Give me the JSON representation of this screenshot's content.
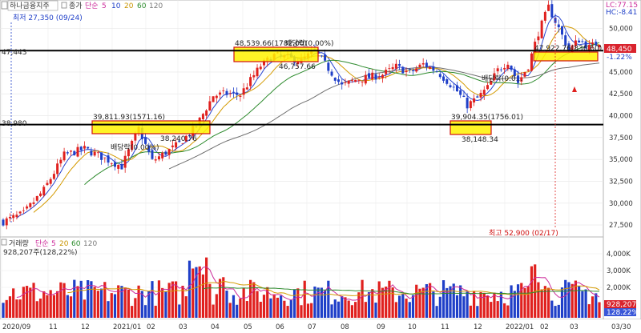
{
  "header": {
    "symbol": "하나금융지주",
    "price_series": "종가",
    "ma_type": "단순",
    "ma_periods": [
      "5",
      "10",
      "20",
      "60",
      "120"
    ],
    "ma_colors": [
      "#1a3cc8",
      "#c89400",
      "#2c8c2c",
      "#7a7a7a"
    ],
    "lc_label": "LC:77.15",
    "hc_label": "HC:-8.41"
  },
  "volume_header": {
    "title": "거래량",
    "ma_type": "단순",
    "ma_periods": [
      "5",
      "20",
      "60",
      "120"
    ],
    "current": "928,207주(128,22%)"
  },
  "annotations": {
    "low_label": "최저 27,350 (09/24)",
    "high_label": "최고 52,900 (02/17)",
    "hline_left_1": "47,443",
    "hline_left_2": "38,980",
    "box1_top": "39,811.93(1571.16)",
    "box1_bottom": "38,240.76",
    "box2_top": "48,539.66(1782.00)",
    "box2_dividend": "배당락(0.00%)",
    "box2_bottom": "46,757.66",
    "box3_top": "39,904.35(1756.01)",
    "box3_bottom": "38,148.34",
    "box4_top": "47,922.76(836.60)",
    "dividend_1": "배당락(0.00%)",
    "dividend_2": "배당락(0.0...",
    "price_badge": "48,450",
    "pct_badge": "-1.22%",
    "vol_badge_1": "928,207",
    "vol_badge_2": "128.22%"
  },
  "colors": {
    "up": "#e0201e",
    "down": "#1f3fc8",
    "ma5": "#2845d0",
    "ma20": "#d49a00",
    "ma60": "#2e8b2e",
    "ma120": "#707070",
    "box_fill": "#fff200",
    "box_border": "#d01010",
    "hline": "#000000"
  },
  "chart_data": {
    "type": "candlestick",
    "y_axis_ticks": [
      "50,000",
      "47,500",
      "45,000",
      "42,500",
      "40,000",
      "37,500",
      "35,000",
      "32,500",
      "30,000",
      "27,500"
    ],
    "y_axis_values": [
      50000,
      47500,
      45000,
      42500,
      40000,
      37500,
      35000,
      32500,
      30000,
      27500
    ],
    "volume_ticks": [
      "4,000K",
      "3,000K",
      "2,000K",
      "1,000K"
    ],
    "x_axis_ticks": [
      "2020/09",
      "11",
      "12",
      "2021/01",
      "02",
      "03",
      "04",
      "05",
      "06",
      "07",
      "08",
      "09",
      "10",
      "11",
      "12",
      "2022/01",
      "02",
      "03",
      "03/30"
    ],
    "ylim": [
      26500,
      52500
    ],
    "horizontal_lines": [
      47443,
      38980
    ],
    "high": {
      "value": 52900,
      "date": "02/17"
    },
    "low": {
      "value": 27350,
      "date": "09/24"
    },
    "last_close": 48450,
    "last_change_pct": -1.22,
    "last_volume": 928207,
    "price_path": [
      [
        0,
        27900
      ],
      [
        6,
        28800
      ],
      [
        12,
        31500
      ],
      [
        18,
        35500
      ],
      [
        24,
        36200
      ],
      [
        30,
        35100
      ],
      [
        35,
        34200
      ],
      [
        40,
        38500
      ],
      [
        44,
        34800
      ],
      [
        48,
        35800
      ],
      [
        52,
        36800
      ],
      [
        57,
        38800
      ],
      [
        62,
        42300
      ],
      [
        66,
        42500
      ],
      [
        70,
        42400
      ],
      [
        76,
        45700
      ],
      [
        80,
        46900
      ],
      [
        84,
        46600
      ],
      [
        88,
        46300
      ],
      [
        92,
        47400
      ],
      [
        96,
        45400
      ],
      [
        100,
        43400
      ],
      [
        104,
        44100
      ],
      [
        108,
        44400
      ],
      [
        112,
        44700
      ],
      [
        116,
        45600
      ],
      [
        120,
        44900
      ],
      [
        124,
        45900
      ],
      [
        128,
        45100
      ],
      [
        131,
        44000
      ],
      [
        134,
        42800
      ],
      [
        137,
        41200
      ],
      [
        140,
        42000
      ],
      [
        143,
        43200
      ],
      [
        146,
        45200
      ],
      [
        149,
        46200
      ],
      [
        152,
        43800
      ],
      [
        155,
        45700
      ],
      [
        158,
        49500
      ],
      [
        161,
        52400
      ],
      [
        164,
        50000
      ],
      [
        167,
        47500
      ],
      [
        170,
        48700
      ],
      [
        173,
        47800
      ],
      [
        176,
        48450
      ]
    ]
  }
}
